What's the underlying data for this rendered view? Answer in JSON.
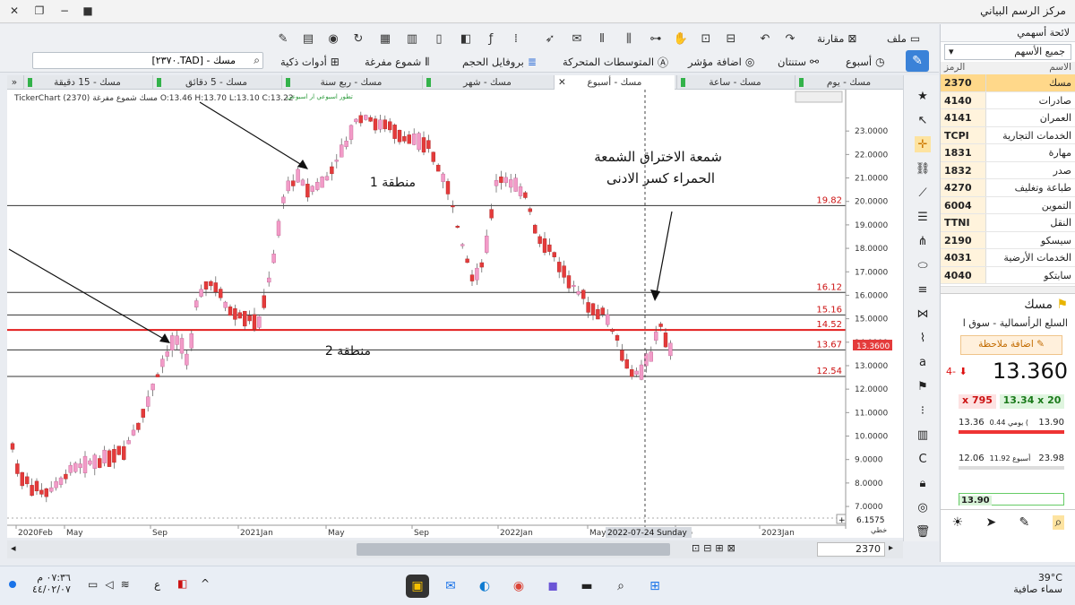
{
  "window": {
    "title": "مركز الرسم البياني"
  },
  "toolbar": {
    "file": "ملف",
    "compare": "مقارنة",
    "week": "أسبوع",
    "stanton": "ستنتان",
    "add_indicator": "اضافة مؤشر",
    "moving_averages": "المتوسطات المتحركة",
    "volume_profile": "بروفايل الحجم",
    "hollow_candles": "شموع مفرغة",
    "smart_tools": "أدوات ذكية",
    "search_value": "مسك - [TAD.٢٣٧٠]"
  },
  "tabs": [
    {
      "label": "مسك - يوم"
    },
    {
      "label": "مسك - ساعة"
    },
    {
      "label": "مسك - أسبوع"
    },
    {
      "label": "مسك - شهر"
    },
    {
      "label": "مسك - ربع سنة"
    },
    {
      "label": "مسك - 5 دقائق"
    },
    {
      "label": "مسك - 15 دقيقة"
    }
  ],
  "chart": {
    "header_info": "TickerChart (2370) مسك شموع مفرغة O:13.46 H:13.70 L:13.10 C:13.22",
    "header_small": "تطور اسبوعي  ار اسبوعي",
    "annotation_main": "شمعة الاختراق الشمعة",
    "annotation_sub": "الحمراء كسر الادنى",
    "zone1": "منطقة 1",
    "zone2": "منطقة 2",
    "crosshair_label": "2022-07-24 Sunday",
    "bottom_value": "6.1575",
    "bottom_tag": "خطي",
    "current_price": "13.3600",
    "symbol_box": "2370"
  },
  "chart_data": {
    "type": "candlestick",
    "ylim": [
      6.2,
      24
    ],
    "y_ticks": [
      "23.0000",
      "22.0000",
      "21.0000",
      "20.0000",
      "19.0000",
      "18.0000",
      "17.0000",
      "16.0000",
      "15.0000",
      "14.0000",
      "13.0000",
      "12.0000",
      "11.0000",
      "10.0000",
      "9.0000",
      "8.0000",
      "7.0000"
    ],
    "x_ticks": [
      "2020Feb",
      "May",
      "Sep",
      "2021Jan",
      "May",
      "Sep",
      "2022Jan",
      "May",
      "Sep",
      "2023Jan"
    ],
    "hlines": [
      {
        "value": 19.82,
        "label": "19.82",
        "color": "#333333"
      },
      {
        "value": 16.12,
        "label": "16.12",
        "color": "#333333"
      },
      {
        "value": 15.16,
        "label": "15.16",
        "color": "#333333"
      },
      {
        "value": 14.52,
        "label": "14.52",
        "color": "#e21d1d"
      },
      {
        "value": 13.67,
        "label": "13.67",
        "color": "#333333"
      },
      {
        "value": 12.54,
        "label": "12.54",
        "color": "#333333"
      }
    ],
    "bull_color": "#f29bc8",
    "bear_color": "#e43b3b"
  },
  "right_tools": [
    "star-icon",
    "cursor-icon",
    "crosshair-icon",
    "link-icon",
    "trend-line-icon",
    "hline-icon",
    "pitchfork-icon",
    "shape-icon",
    "fib-icon",
    "pattern-icon",
    "brush-icon",
    "text-icon",
    "flag-icon",
    "indicators-icon",
    "measure-icon",
    "clear-icon",
    "lock-icon",
    "eye-icon",
    "trash-icon"
  ],
  "panel": {
    "title": "لائحة أسهمي",
    "filter": "جميع الأسهم",
    "col_symbol": "الرمز",
    "col_name": "الاسم",
    "rows": [
      {
        "sym": "2370",
        "name": "مسك"
      },
      {
        "sym": "4140",
        "name": "صادرات"
      },
      {
        "sym": "4141",
        "name": "العمران"
      },
      {
        "sym": "TCPI",
        "name": "الخدمات التجارية"
      },
      {
        "sym": "1831",
        "name": "مهارة"
      },
      {
        "sym": "1832",
        "name": "صدر"
      },
      {
        "sym": "4270",
        "name": "طباعة وتغليف"
      },
      {
        "sym": "6004",
        "name": "التموين"
      },
      {
        "sym": "TTNI",
        "name": "النقل"
      },
      {
        "sym": "2190",
        "name": "سيسكو"
      },
      {
        "sym": "4031",
        "name": "الخدمات الأرضية"
      },
      {
        "sym": "4040",
        "name": "سابتكو"
      }
    ],
    "stock_name": "مسك",
    "market": "السلع الرأسمالية - سوق ا",
    "add_note": "اضافة ملاحظة",
    "price": "13.360",
    "change": "4-",
    "bid": "x 795",
    "ask": "13.34 x 20",
    "day_low": "13.36",
    "day_label": "يومي 0.44 (",
    "day_high": "13.90",
    "week_low": "12.06",
    "week_label": "أسبوع 11.92",
    "week_high": "23.98",
    "box_val": "13.90"
  },
  "taskbar": {
    "weather_temp": "39°C",
    "weather_text": "سماء صافية",
    "time": "٠٧:٣٦ م",
    "date": "٤٤/٠٢/٠٧",
    "lang": "ع"
  }
}
